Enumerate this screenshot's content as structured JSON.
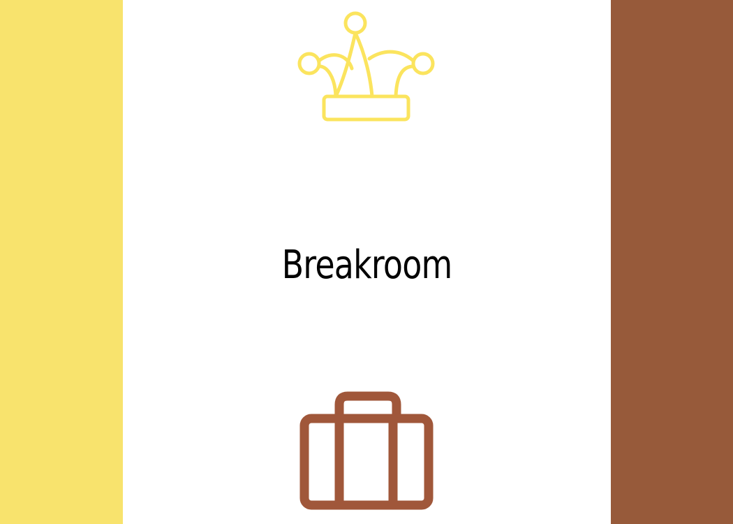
{
  "colors": {
    "left_band": "#f8e36d",
    "right_band": "#975a3a",
    "jester_icon": "#fbe45e",
    "briefcase_icon": "#a0573a",
    "title_text": "#000000"
  },
  "icons": {
    "top": "jester-hat-icon",
    "bottom": "briefcase-icon"
  },
  "title": "Breakroom"
}
